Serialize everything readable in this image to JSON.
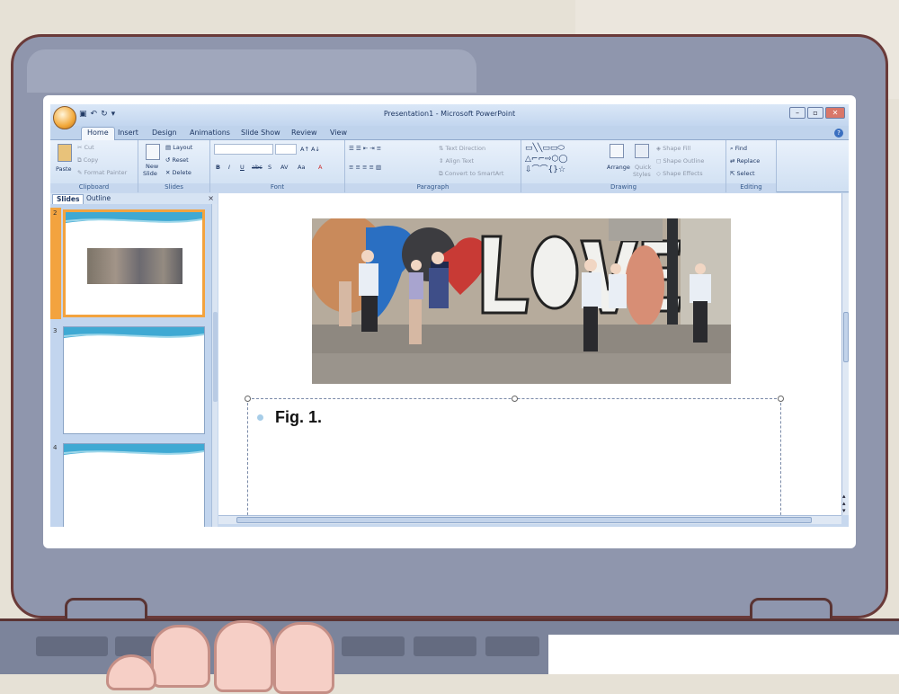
{
  "window": {
    "title": "Presentation1 - Microsoft PowerPoint"
  },
  "tabs": [
    "Home",
    "Insert",
    "Design",
    "Animations",
    "Slide Show",
    "Review",
    "View"
  ],
  "ribbon": {
    "clipboard": {
      "paste": "Paste",
      "cut": "Cut",
      "copy": "Copy",
      "format_painter": "Format Painter",
      "label": "Clipboard"
    },
    "slides": {
      "new_slide_1": "New",
      "new_slide_2": "Slide",
      "layout": "Layout",
      "reset": "Reset",
      "delete": "Delete",
      "label": "Slides"
    },
    "font": {
      "bold": "B",
      "italic": "I",
      "underline": "U",
      "strike": "abc",
      "shadow": "S",
      "spacing": "AV",
      "case": "Aa",
      "color": "A",
      "label": "Font"
    },
    "paragraph": {
      "text_direction": "Text Direction",
      "align_text": "Align Text",
      "convert": "Convert to SmartArt",
      "label": "Paragraph"
    },
    "drawing": {
      "arrange": "Arrange",
      "quick_styles_1": "Quick",
      "quick_styles_2": "Styles",
      "shape_fill": "Shape Fill",
      "shape_outline": "Shape Outline",
      "shape_effects": "Shape Effects",
      "label": "Drawing"
    },
    "editing": {
      "find": "Find",
      "replace": "Replace",
      "select": "Select",
      "label": "Editing"
    }
  },
  "pane": {
    "tab_slides": "Slides",
    "tab_outline": "Outline",
    "close": "×",
    "slide_numbers": [
      "2",
      "3",
      "4"
    ]
  },
  "slide": {
    "body_text": "Fig. 1."
  },
  "colors": {
    "accent": "#f3a33f",
    "ribbon": "#dbe7f6",
    "frame": "#8f96ad"
  }
}
